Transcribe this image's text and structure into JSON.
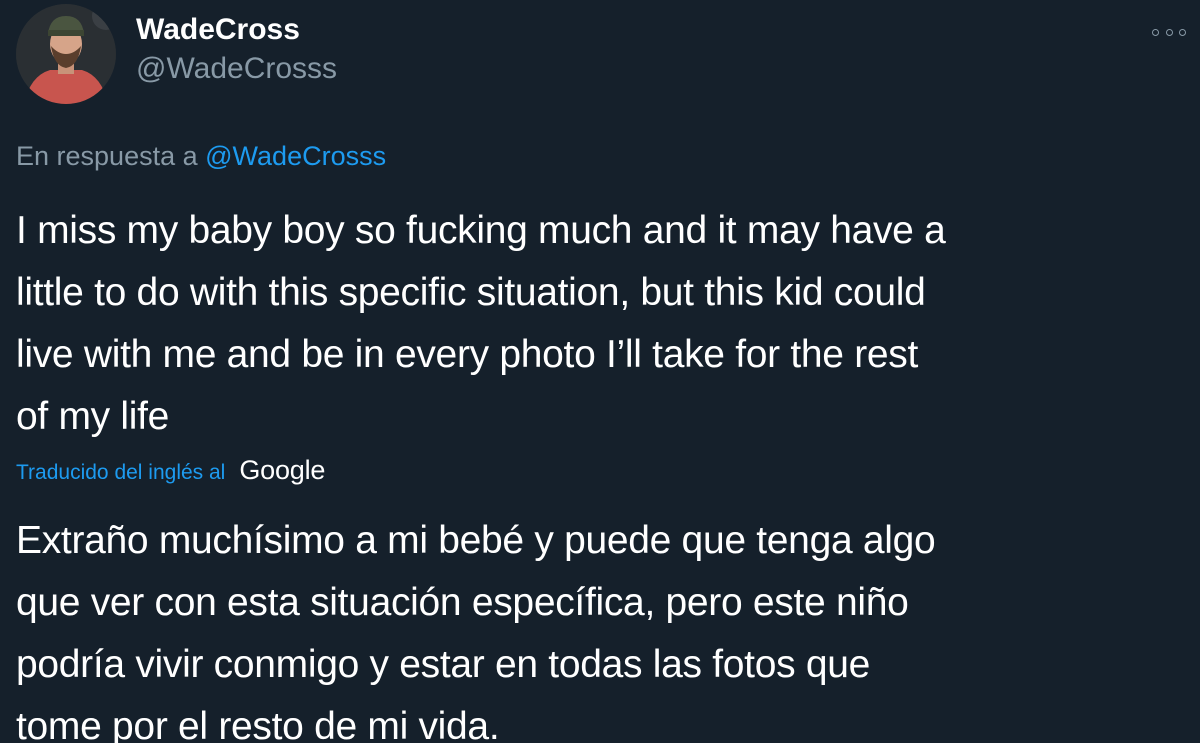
{
  "tweet": {
    "display_name": "WadeCross",
    "handle": "@WadeCrosss",
    "reply_prefix": "En respuesta a",
    "reply_to": "@WadeCrosss",
    "body_lines": [
      "I miss my baby boy so fucking much and it may have a",
      "little to do with this specific situation, but this kid could",
      "live with me and be in every photo I’ll take for the rest",
      "of my life"
    ],
    "translated_label": "Traducido del inglés al",
    "translation_provider": "Google",
    "translation_lines": [
      "Extraño muchísimo a mi bebé y puede que tenga algo",
      "que ver con esta situación específica, pero este niño",
      "podría vivir conmigo y estar en todas las fotos que",
      "tome por el resto de mi vida."
    ]
  },
  "icons": {
    "avatar": "avatar-photo",
    "more": "more-options-icon"
  },
  "colors": {
    "background": "#15202b",
    "primary_text": "#ffffff",
    "secondary_text": "#8899a6",
    "accent": "#1d9bf0"
  }
}
